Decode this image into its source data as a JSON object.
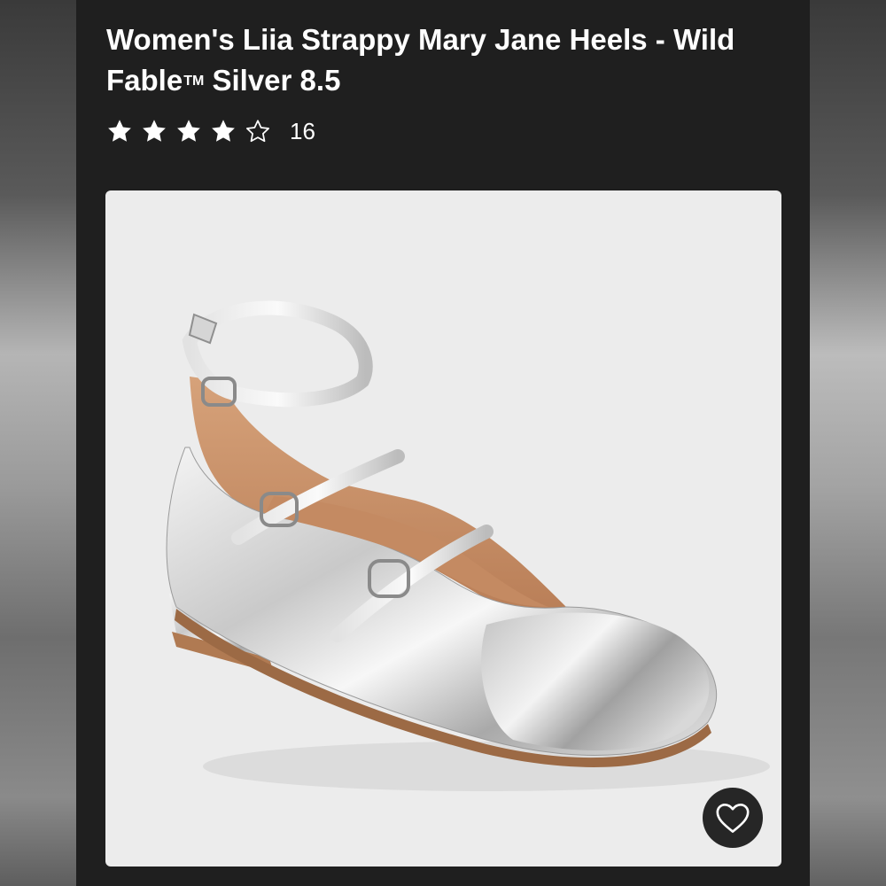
{
  "product": {
    "title_main": "Women's Liia Strappy Mary Jane Heels - Wild Fable",
    "trademark": "TM",
    "title_suffix": " Silver 8.5",
    "rating": 4,
    "rating_max": 5,
    "review_count": "16"
  },
  "icons": {
    "star_filled": "star-icon",
    "star_empty": "star-outline-icon",
    "favorite": "heart-icon"
  },
  "colors": {
    "background": "#1f1f1f",
    "card": "#ececec",
    "text": "#ffffff"
  }
}
